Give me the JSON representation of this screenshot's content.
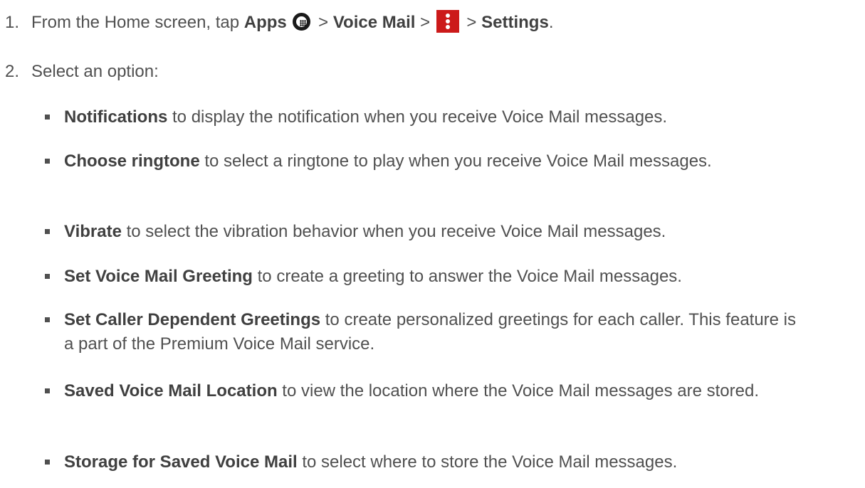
{
  "step1": {
    "number": "1.",
    "text_a": "From the Home screen, tap ",
    "apps": "Apps",
    "sep1": " > ",
    "voice_mail": "Voice Mail",
    "sep2": " > ",
    "sep3": " > ",
    "settings": "Settings",
    "period": ".",
    "icons": [
      "apps-grid-icon",
      "menu-dots-icon"
    ],
    "menu_icon_color": "#cc1a1a"
  },
  "step2": {
    "number": "2.",
    "text": "Select an option:"
  },
  "options": [
    {
      "term": "Notifications",
      "desc": " to display the notification when you receive Voice Mail messages."
    },
    {
      "term": "Choose ringtone",
      "desc": " to select a ringtone to play when you receive Voice Mail messages."
    },
    {
      "term": "Vibrate",
      "desc": " to select the vibration behavior when you receive Voice Mail messages."
    },
    {
      "term": "Set Voice Mail Greeting",
      "desc": " to create a greeting to answer the Voice Mail messages."
    },
    {
      "term": "Set Caller Dependent Greetings",
      "desc": " to create personalized greetings for each caller. This feature is a part of the Premium Voice Mail service."
    },
    {
      "term": "Saved Voice Mail Location",
      "desc": " to view the location where the Voice Mail messages are stored."
    },
    {
      "term": "Storage for Saved Voice Mail",
      "desc": " to select where to store the Voice Mail messages."
    }
  ]
}
